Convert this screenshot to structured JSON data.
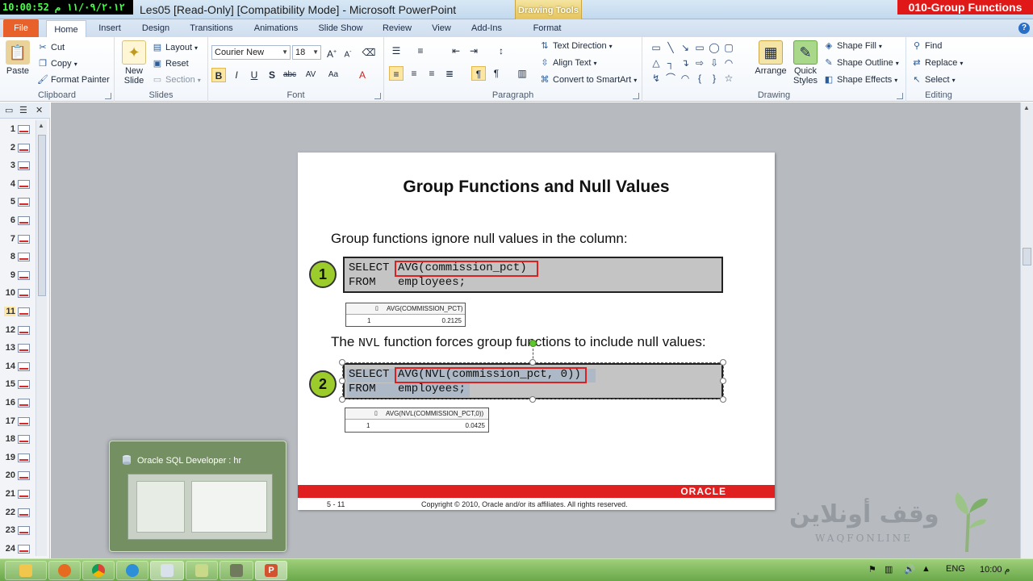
{
  "window": {
    "clock": "10:00:52 ١١/٠٩/٢٠١٢ م",
    "title": "Les05 [Read-Only] [Compatibility Mode]  -  Microsoft PowerPoint",
    "contextual_tab": "Drawing Tools",
    "corner_label": "010-Group Functions"
  },
  "tabs": [
    "File",
    "Home",
    "Insert",
    "Design",
    "Transitions",
    "Animations",
    "Slide Show",
    "Review",
    "View",
    "Add-Ins",
    "Format"
  ],
  "ribbon": {
    "clipboard": {
      "paste": "Paste",
      "cut": "Cut",
      "copy": "Copy",
      "format_painter": "Format Painter",
      "label": "Clipboard"
    },
    "slides": {
      "new_slide": "New Slide",
      "layout": "Layout",
      "reset": "Reset",
      "section": "Section",
      "label": "Slides"
    },
    "font": {
      "family": "Courier New",
      "size": "18",
      "label": "Font"
    },
    "paragraph": {
      "text_direction": "Text Direction",
      "align_text": "Align Text",
      "convert_smartart": "Convert to SmartArt",
      "label": "Paragraph"
    },
    "drawing": {
      "arrange": "Arrange",
      "quick_styles": "Quick Styles",
      "shape_fill": "Shape Fill",
      "shape_outline": "Shape Outline",
      "shape_effects": "Shape Effects",
      "label": "Drawing"
    },
    "editing": {
      "find": "Find",
      "replace": "Replace",
      "select": "Select",
      "label": "Editing"
    }
  },
  "slide_pane": {
    "numbers": [
      "1",
      "2",
      "3",
      "4",
      "5",
      "6",
      "7",
      "8",
      "9",
      "10",
      "11",
      "12",
      "13",
      "14",
      "15",
      "16",
      "17",
      "18",
      "19",
      "20",
      "21",
      "22",
      "23",
      "24"
    ],
    "selected": "11"
  },
  "slide": {
    "title": "Group Functions and Null Values",
    "bullet1": "Group functions ignore null values in the column:",
    "badge1": "1",
    "code1_line1_kw": "SELECT",
    "code1_line1_expr": "AVG(commission_pct)",
    "code1_line2_kw": "FROM",
    "code1_line2_tbl": "employees;",
    "result1_header": "AVG(COMMISSION_PCT)",
    "result1_row": "1",
    "result1_value": "0.2125",
    "nvl_pre": "The ",
    "nvl_mono": "NVL",
    "nvl_post": " function forces group functions to include null values:",
    "badge2": "2",
    "code2_line1_kw": "SELECT",
    "code2_line1_expr": "AVG(NVL(commission_pct, 0))",
    "code2_line2_kw": "FROM",
    "code2_line2_tbl": "employees;",
    "result2_header": "AVG(NVL(COMMISSION_PCT,0))",
    "result2_row": "1",
    "result2_value": "0.0425",
    "oracle": "ORACLE",
    "page": "5 - 11",
    "copyright": "Copyright © 2010, Oracle and/or its affiliates.  All rights reserved."
  },
  "watermark": {
    "arabic": "وقف أونلاين",
    "latin": "WAQFONLINE"
  },
  "preview": {
    "title": "Oracle SQL Developer : hr"
  },
  "tray": {
    "lang": "ENG",
    "time": "10:00 م"
  }
}
